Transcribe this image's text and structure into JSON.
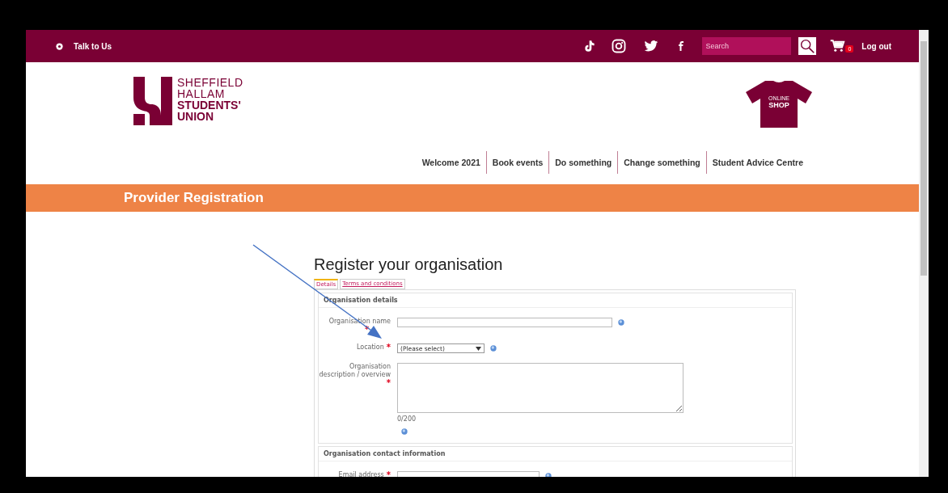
{
  "top_bar": {
    "talk_link": "Talk to Us",
    "search": {
      "placeholder": "Search"
    },
    "cart_count": "0",
    "logout": "Log out"
  },
  "logo": {
    "lines": [
      "SHEFFIELD",
      "HALLAM",
      "STUDENTS'",
      "UNION"
    ]
  },
  "shop": {
    "lines": [
      "ONLINE",
      "SHOP"
    ]
  },
  "nav": [
    {
      "label": "Welcome 2021"
    },
    {
      "label": "Book events"
    },
    {
      "label": "Do something"
    },
    {
      "label": "Change something"
    },
    {
      "label": "Student Advice Centre"
    }
  ],
  "banner": {
    "title": "Provider Registration"
  },
  "heading": "Register your organisation",
  "tabs": [
    {
      "label": "Details",
      "selected": true
    },
    {
      "label": "Terms and conditions",
      "selected": false
    }
  ],
  "sections": [
    {
      "title": "Organisation details",
      "fields": [
        {
          "kind": "text",
          "label": "Organisation name",
          "required_mark": "*",
          "mark_below": true
        },
        {
          "kind": "select",
          "label": "Location",
          "required_mark": "*",
          "value": "(Please select)"
        },
        {
          "kind": "textarea",
          "label": "Organisation description / overview",
          "required_mark": "*",
          "counter": "0/200"
        }
      ]
    },
    {
      "title": "Organisation contact information",
      "fields": [
        {
          "kind": "text",
          "label": "Email address",
          "required_mark": "*"
        }
      ]
    }
  ]
}
